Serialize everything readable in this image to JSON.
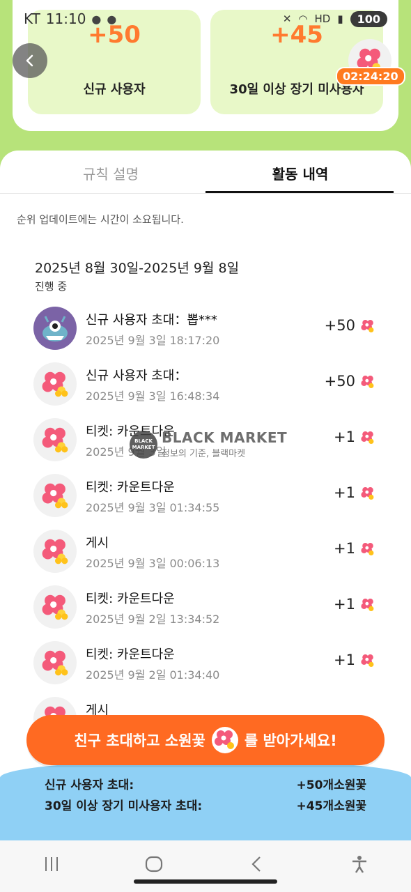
{
  "status_bar": {
    "carrier": "KT",
    "time": "11:10",
    "battery": "100",
    "hd_label": "HD"
  },
  "top": {
    "rewards": [
      {
        "amount": "+50",
        "label": "신규 사용자"
      },
      {
        "amount": "+45",
        "label": "30일 이상 장기 미사용자"
      }
    ],
    "timer": "02:24:20"
  },
  "tabs": [
    {
      "label": "규칙 설명",
      "active": false
    },
    {
      "label": "활동 내역",
      "active": true
    }
  ],
  "notice": "순위 업데이트에는 시간이 소요됩니다.",
  "period": "2025년 8월 30일-2025년 9월 8일",
  "period_status": "진행 중",
  "activities": [
    {
      "title": "신규 사용자 초대：뽑***",
      "time": "2025년 9월 3일 18:17:20",
      "points": "+50",
      "avatar": "monster"
    },
    {
      "title": "신규 사용자 초대：",
      "time": "2025년 9월 3일 16:48:34",
      "points": "+50",
      "avatar": "flower"
    },
    {
      "title": "티켓: 카운트다운",
      "time": "2025년 9월 3일",
      "points": "+1",
      "avatar": "flower"
    },
    {
      "title": "티켓: 카운트다운",
      "time": "2025년 9월 3일 01:34:55",
      "points": "+1",
      "avatar": "flower"
    },
    {
      "title": "게시",
      "time": "2025년 9월 3일 00:06:13",
      "points": "+1",
      "avatar": "flower"
    },
    {
      "title": "티켓: 카운트다운",
      "time": "2025년 9월 2일 13:34:52",
      "points": "+1",
      "avatar": "flower"
    },
    {
      "title": "티켓: 카운트다운",
      "time": "2025년 9월 2일 01:34:40",
      "points": "+1",
      "avatar": "flower"
    },
    {
      "title": "게시",
      "time": "",
      "points": "",
      "avatar": "flower"
    }
  ],
  "watermark": {
    "logo_text": "BLACK MARKET",
    "title": "BLACK MARKET",
    "subtitle": "정보의 기준, 블랙마켓"
  },
  "cta": {
    "before": "친구 초대하고 소원꽃",
    "after": "를 받아가세요!"
  },
  "bottom_info": [
    {
      "label": "신규 사용자 초대:",
      "value": "+50개소원꽃"
    },
    {
      "label": "30일 이상 장기 미사용자 초대:",
      "value": "+45개소원꽃"
    }
  ],
  "colors": {
    "page_bg": "#b7e37a",
    "accent_orange": "#ff6a22",
    "reward_box": "#e8f8c8",
    "bottom_blue": "#8fd0f5"
  },
  "icons": {
    "back": "chevron-left-icon",
    "flower": "wish-flower-icon",
    "nav_recents": "recents-icon",
    "nav_home": "home-icon",
    "nav_back": "back-icon",
    "nav_accessibility": "accessibility-icon"
  }
}
